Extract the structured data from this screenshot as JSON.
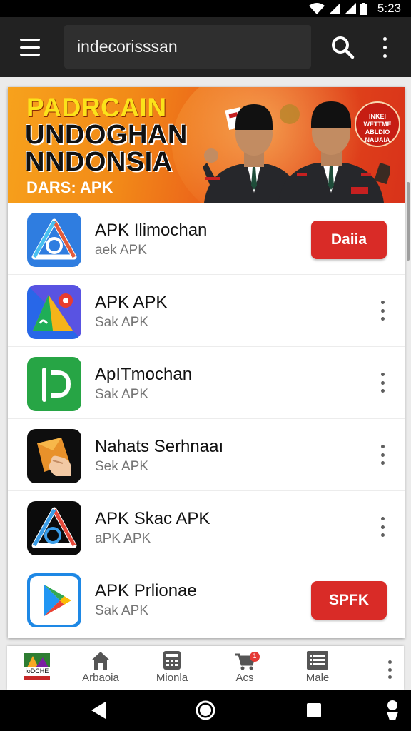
{
  "status_bar": {
    "time": "5:23",
    "icons": [
      "wifi-icon",
      "signal-icon",
      "signal-icon",
      "battery-icon"
    ]
  },
  "app_bar": {
    "search_value": "indecorisssan",
    "icons": [
      "menu-icon",
      "search-icon",
      "more-vert-icon"
    ]
  },
  "banner": {
    "line1": "PADRCAIN",
    "line2": "UNDOGHAN",
    "line3": "NNDONSIA",
    "line4": "DARS: APK",
    "badge": "INKEI WETTME ABLDIO NAUAIA",
    "colors": {
      "primary": "#f28a18",
      "accent": "#d8321a",
      "title": "#fbe21a"
    }
  },
  "apps": [
    {
      "name": "APK Ilimochan",
      "sub": "aek APK",
      "action": "Daiia",
      "icon": "triangle-logo-icon"
    },
    {
      "name": "APK  APK",
      "sub": "Sak APK",
      "action": "",
      "icon": "map-pin-triangle-icon"
    },
    {
      "name": "ApITmochan",
      "sub": "Sak APK",
      "action": "",
      "icon": "green-p-icon"
    },
    {
      "name": "Nahats  Serhnaaı",
      "sub": "Sek APK",
      "action": "",
      "icon": "hand-tap-icon"
    },
    {
      "name": "APK Skac APK",
      "sub": "aPK APK",
      "action": "",
      "icon": "triangle-logo-dark-icon"
    },
    {
      "name": "APK Prlionae",
      "sub": "Sak APK",
      "action": "SPFK",
      "icon": "play-store-icon"
    }
  ],
  "tab_bar": {
    "thumb_text": "ioDCHE",
    "tabs": [
      {
        "label": "Arbaoia",
        "icon": "home-icon"
      },
      {
        "label": "Mionla",
        "icon": "calculator-icon"
      },
      {
        "label": "Acs",
        "icon": "cart-icon",
        "badge": "1"
      },
      {
        "label": "Male",
        "icon": "list-icon"
      }
    ]
  },
  "system_nav": {
    "icons": [
      "back-icon",
      "home-circle-icon",
      "recents-icon",
      "accessibility-icon"
    ]
  },
  "colors": {
    "app_bar": "#222222",
    "action_button": "#d92b27",
    "background": "#ebebeb"
  }
}
